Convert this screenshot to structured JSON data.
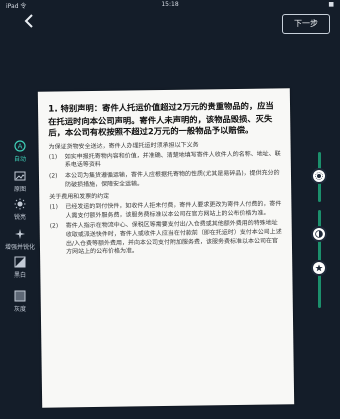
{
  "status_bar": {
    "carrier": "iPad 令",
    "time": "15:18",
    "battery": "■"
  },
  "header": {
    "next_label": "下一步"
  },
  "tools": [
    {
      "label": "自动",
      "icon": "auto-icon"
    },
    {
      "label": "原图",
      "icon": "image-icon"
    },
    {
      "label": "锐亮",
      "icon": "sun-icon"
    },
    {
      "label": "增强并锐化",
      "icon": "sparkle-icon"
    },
    {
      "label": "黑白",
      "icon": "bw-icon"
    },
    {
      "label": "灰度",
      "icon": "grayscale-icon"
    }
  ],
  "accent_color": "#3fd0b8",
  "document": {
    "heading_num": "1.",
    "heading": "特别声明：寄件人托运价值超过2万元的贵重物品的，应当在托运时向本公司声明。寄件人未声明的，该物品毁损、灭失后，本公司有权按照不超过2万元的一般物品予以赔偿。",
    "para1": "为保证货物安全送达，寄件人办理托运时须承担以下义务",
    "item1_num": "(1)",
    "item1": "如实申报托寄物内容和价值，并准确、清楚地填写寄件人收件人的名称、地址、联系电话等资料",
    "item2_num": "(2)",
    "item2": "本公司为集货遵循运输，寄件人应根据托寄物的性质(尤其是易碎品)，提供充分的防破损措施，保障安全运输。",
    "para2": "关于费用和发票的约定",
    "item3_num": "(1)",
    "item3": "已经发运的到付快件，如收件人拒未付费，寄件人要求更改为寄件人付费的，寄件人需支付额外服务费，该服务费标准以本公司在官方网站上的公布价格为准。",
    "item4_num": "(2)",
    "item4": "寄件人指示在物流中心、保税区等需要支付出/入仓费或其他额外费用的特殊地址收取或派送快件时，寄件人或收件人应当在付款前（即在托运时）支付本公司上述出/入仓费等额外费用，并向本公司支付附加服务费，该服务费标准以本公司在官方网站上的公布价格为准。"
  },
  "sliders": [
    {
      "name": "brightness",
      "level": 0.15
    },
    {
      "name": "contrast",
      "level": 0.55
    },
    {
      "name": "detail",
      "level": 0.7
    }
  ]
}
